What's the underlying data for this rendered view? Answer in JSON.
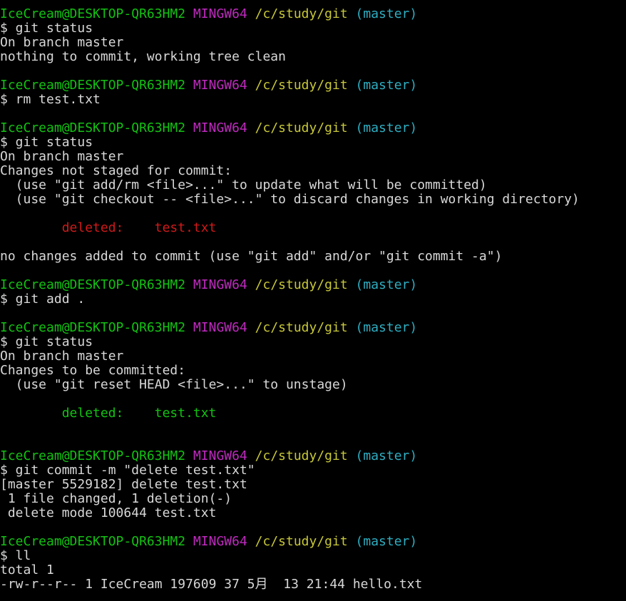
{
  "prompt": {
    "user": "IceCream@DESKTOP-QR63HM2",
    "system": "MINGW64",
    "path": "/c/study/git",
    "branch": "(master)"
  },
  "colors": {
    "background": "#000000",
    "text": "#d8d8d8",
    "user": "#13c213",
    "system": "#c02ac0",
    "path": "#c8c83a",
    "branch": "#2eaec2",
    "deleted_unstaged": "#d01a1a",
    "deleted_staged": "#13c213"
  },
  "lines": [
    {
      "type": "prompt"
    },
    {
      "type": "text",
      "text": "$ git status"
    },
    {
      "type": "text",
      "text": "On branch master"
    },
    {
      "type": "text",
      "text": "nothing to commit, working tree clean"
    },
    {
      "type": "text",
      "text": ""
    },
    {
      "type": "prompt"
    },
    {
      "type": "text",
      "text": "$ rm test.txt"
    },
    {
      "type": "text",
      "text": ""
    },
    {
      "type": "prompt"
    },
    {
      "type": "text",
      "text": "$ git status"
    },
    {
      "type": "text",
      "text": "On branch master"
    },
    {
      "type": "text",
      "text": "Changes not staged for commit:"
    },
    {
      "type": "text",
      "text": "  (use \"git add/rm <file>...\" to update what will be committed)"
    },
    {
      "type": "text",
      "text": "  (use \"git checkout -- <file>...\" to discard changes in working directory)"
    },
    {
      "type": "text",
      "text": ""
    },
    {
      "type": "text",
      "text": "        deleted:    test.txt",
      "color": "del-red"
    },
    {
      "type": "text",
      "text": ""
    },
    {
      "type": "text",
      "text": "no changes added to commit (use \"git add\" and/or \"git commit -a\")"
    },
    {
      "type": "text",
      "text": ""
    },
    {
      "type": "prompt"
    },
    {
      "type": "text",
      "text": "$ git add ."
    },
    {
      "type": "text",
      "text": ""
    },
    {
      "type": "prompt"
    },
    {
      "type": "text",
      "text": "$ git status"
    },
    {
      "type": "text",
      "text": "On branch master"
    },
    {
      "type": "text",
      "text": "Changes to be committed:"
    },
    {
      "type": "text",
      "text": "  (use \"git reset HEAD <file>...\" to unstage)"
    },
    {
      "type": "text",
      "text": ""
    },
    {
      "type": "text",
      "text": "        deleted:    test.txt",
      "color": "del-green"
    },
    {
      "type": "text",
      "text": ""
    },
    {
      "type": "text",
      "text": ""
    },
    {
      "type": "prompt"
    },
    {
      "type": "text",
      "text": "$ git commit -m \"delete test.txt\""
    },
    {
      "type": "text",
      "text": "[master 5529182] delete test.txt"
    },
    {
      "type": "text",
      "text": " 1 file changed, 1 deletion(-)"
    },
    {
      "type": "text",
      "text": " delete mode 100644 test.txt"
    },
    {
      "type": "text",
      "text": ""
    },
    {
      "type": "prompt"
    },
    {
      "type": "text",
      "text": "$ ll"
    },
    {
      "type": "text",
      "text": "total 1"
    },
    {
      "type": "text",
      "text": "-rw-r--r-- 1 IceCream 197609 37 5月  13 21:44 hello.txt"
    }
  ]
}
